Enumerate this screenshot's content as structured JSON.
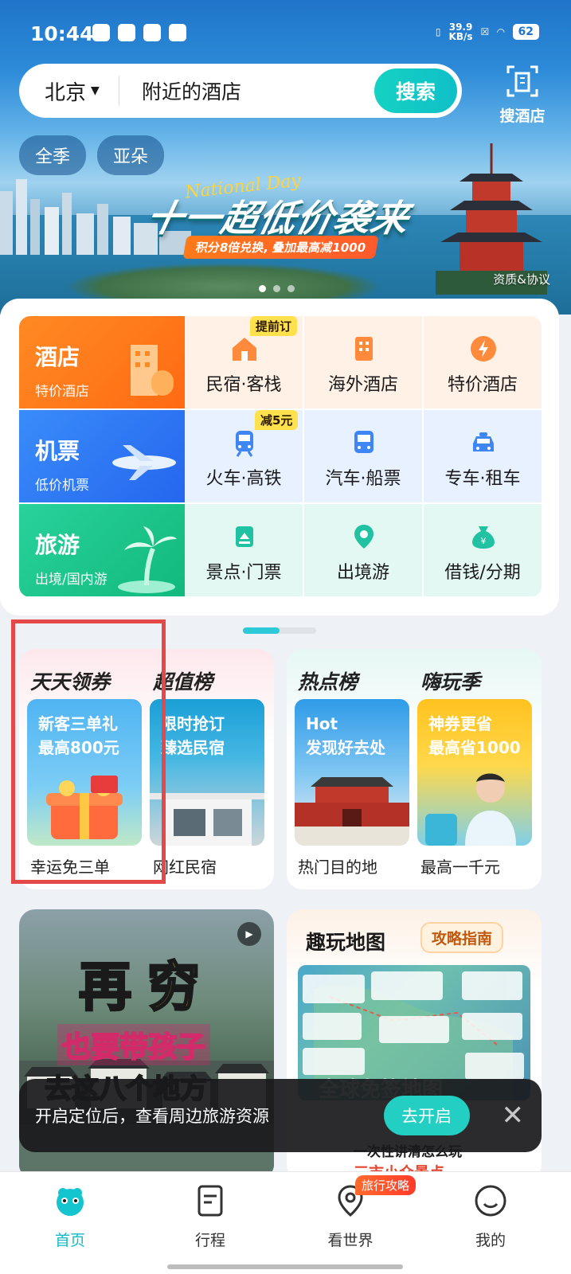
{
  "status_bar": {
    "time": "10:44",
    "net_speed_value": "39.9",
    "net_speed_unit": "KB/s",
    "battery": "62"
  },
  "search": {
    "city": "北京",
    "query": "附近的酒店",
    "button": "搜索",
    "hotel_search_label": "搜酒店"
  },
  "chips": [
    "全季",
    "亚朵"
  ],
  "banner": {
    "script": "National Day",
    "title": "十一超低价袭来",
    "subtitle": "积分8倍兑换, 叠加最高减1000",
    "qualification": "资质&协议",
    "page_count": 3,
    "active_page": 1
  },
  "services": {
    "main": [
      {
        "title": "酒店",
        "sub": "特价酒店",
        "color": "#ff7a1a"
      },
      {
        "title": "机票",
        "sub": "低价机票",
        "color": "#2f7cf6"
      },
      {
        "title": "旅游",
        "sub": "出境/国内游",
        "color": "#20c88a"
      }
    ],
    "rows": [
      [
        {
          "label": "民宿·客栈",
          "badge": "提前订",
          "icon": "house-icon"
        },
        {
          "label": "海外酒店",
          "icon": "building-icon"
        },
        {
          "label": "特价酒店",
          "icon": "lightning-icon"
        }
      ],
      [
        {
          "label": "火车·高铁",
          "badge": "减5元",
          "icon": "train-icon"
        },
        {
          "label": "汽车·船票",
          "icon": "bus-icon"
        },
        {
          "label": "专车·租车",
          "icon": "car-icon"
        }
      ],
      [
        {
          "label": "景点·门票",
          "icon": "ticket-icon"
        },
        {
          "label": "出境游",
          "icon": "location-icon"
        },
        {
          "label": "借钱/分期",
          "icon": "moneybag-icon"
        }
      ]
    ]
  },
  "promos": {
    "left": {
      "headers": [
        "天天领券",
        "超值榜"
      ],
      "items": [
        {
          "text": "新客三单礼\n最高800元",
          "caption": "幸运免三单"
        },
        {
          "text": "限时抢订\n臻选民宿",
          "caption": "网红民宿"
        }
      ]
    },
    "right": {
      "headers": [
        "热点榜",
        "嗨玩季"
      ],
      "items": [
        {
          "text": "Hot\n发现好去处",
          "caption": "热门目的地"
        },
        {
          "text": "神券更省\n最高省1000",
          "caption": "最高一千元"
        }
      ]
    }
  },
  "video_card": {
    "line1": "再穷",
    "line2": "也要带孩子",
    "line3": "去这八个地方"
  },
  "map_card": {
    "title": "趣玩地图",
    "badge": "攻略指南",
    "map_caption": "全球免签地图",
    "note1": "一次性讲清怎么玩",
    "note2": "三市小众景点"
  },
  "toast": {
    "message": "开启定位后，查看周边旅游资源",
    "action": "去开启"
  },
  "tabs": [
    {
      "label": "首页",
      "icon": "home-icon",
      "active": true
    },
    {
      "label": "行程",
      "icon": "itinerary-icon"
    },
    {
      "label": "看世界",
      "icon": "explore-icon",
      "badge": "旅行攻略"
    },
    {
      "label": "我的",
      "icon": "profile-icon"
    }
  ],
  "colors": {
    "accent": "#12b9c6",
    "highlight_box": "#e54848"
  }
}
